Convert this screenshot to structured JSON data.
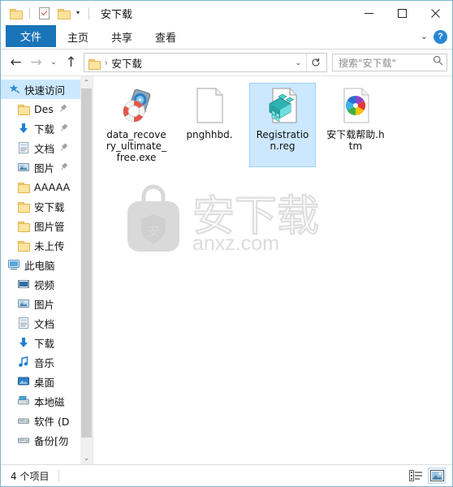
{
  "window": {
    "title": "安下载",
    "quick_access": [
      {
        "name": "folder-icon",
        "label": "folder"
      },
      {
        "name": "properties-icon",
        "label": "properties"
      },
      {
        "name": "new-folder-icon",
        "label": "new folder"
      }
    ],
    "qat_dropdown": "▾",
    "controls": {
      "minimize": "minimize",
      "maximize": "maximize",
      "close": "close"
    }
  },
  "ribbon": {
    "tabs": [
      {
        "label": "文件",
        "active": true
      },
      {
        "label": "主页",
        "active": false
      },
      {
        "label": "共享",
        "active": false
      },
      {
        "label": "查看",
        "active": false
      }
    ],
    "expand_label": "⌄",
    "help_label": "?"
  },
  "address": {
    "back": "←",
    "forward": "→",
    "history": "⌄",
    "up": "↑",
    "breadcrumb_separator": "›",
    "path": "安下载",
    "dropdown": "⌄",
    "refresh": "↻"
  },
  "search": {
    "placeholder": "搜索\"安下载\""
  },
  "sidebar": {
    "items": [
      {
        "label": "快速访问",
        "icon": "star-pin-icon",
        "level": 0,
        "selected": true,
        "pinned": false
      },
      {
        "label": "Des",
        "icon": "folder-icon",
        "level": 1,
        "selected": false,
        "pinned": true
      },
      {
        "label": "下载",
        "icon": "download-icon",
        "level": 1,
        "selected": false,
        "pinned": true
      },
      {
        "label": "文档",
        "icon": "documents-icon",
        "level": 1,
        "selected": false,
        "pinned": true
      },
      {
        "label": "图片",
        "icon": "pictures-icon",
        "level": 1,
        "selected": false,
        "pinned": true
      },
      {
        "label": "AAAAA",
        "icon": "folder-icon",
        "level": 1,
        "selected": false,
        "pinned": false
      },
      {
        "label": "安下载",
        "icon": "folder-icon",
        "level": 1,
        "selected": false,
        "pinned": false
      },
      {
        "label": "图片管",
        "icon": "folder-icon",
        "level": 1,
        "selected": false,
        "pinned": false
      },
      {
        "label": "未上传",
        "icon": "folder-icon",
        "level": 1,
        "selected": false,
        "pinned": false
      },
      {
        "label": "此电脑",
        "icon": "this-pc-icon",
        "level": 0,
        "selected": false,
        "pinned": false
      },
      {
        "label": "视频",
        "icon": "videos-icon",
        "level": 1,
        "selected": false,
        "pinned": false
      },
      {
        "label": "图片",
        "icon": "pictures-icon",
        "level": 1,
        "selected": false,
        "pinned": false
      },
      {
        "label": "文档",
        "icon": "documents-icon",
        "level": 1,
        "selected": false,
        "pinned": false
      },
      {
        "label": "下载",
        "icon": "download-icon",
        "level": 1,
        "selected": false,
        "pinned": false
      },
      {
        "label": "音乐",
        "icon": "music-icon",
        "level": 1,
        "selected": false,
        "pinned": false
      },
      {
        "label": "桌面",
        "icon": "desktop-icon",
        "level": 1,
        "selected": false,
        "pinned": false
      },
      {
        "label": "本地磁",
        "icon": "local-disk-icon",
        "level": 1,
        "selected": false,
        "pinned": false
      },
      {
        "label": "软件 (D",
        "icon": "drive-icon",
        "level": 1,
        "selected": false,
        "pinned": false
      },
      {
        "label": "备份[勿",
        "icon": "drive-icon",
        "level": 1,
        "selected": false,
        "pinned": false
      }
    ],
    "scroll_up": "⌃",
    "scroll_down": "⌄"
  },
  "files": [
    {
      "name": "data_recovery_ultimate_free.exe",
      "icon": "data-recovery-app-icon",
      "selected": false
    },
    {
      "name": "pnghhbd.",
      "icon": "blank-document-icon",
      "selected": false
    },
    {
      "name": "Registration.reg",
      "icon": "registry-file-icon",
      "selected": true
    },
    {
      "name": "安下载帮助.htm",
      "icon": "html-document-icon",
      "selected": false
    }
  ],
  "watermark": {
    "site": "anxz.com",
    "brand": "安下载"
  },
  "statusbar": {
    "count_text": "4 个项目",
    "details_view": "details-view",
    "large_icons_view": "large-icons-view"
  }
}
